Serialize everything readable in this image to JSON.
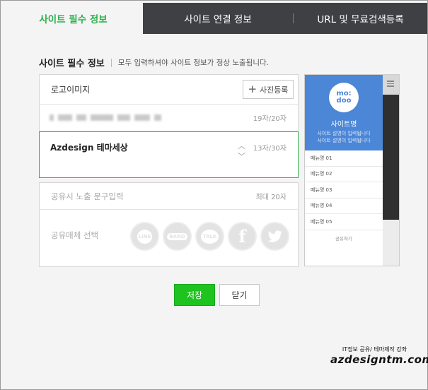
{
  "tabs": {
    "required": "사이트 필수 정보",
    "connect": "사이트 연결 정보",
    "url": "URL 및 무료검색등록"
  },
  "section": {
    "title": "사이트 필수 정보",
    "description": "모두 입력하셔야 사이트 정보가 정상 노출됩니다."
  },
  "form": {
    "logo_label": "로고이미지",
    "photo_button": "사진등록",
    "site_name_count": "19자/20자",
    "site_desc_value": "Azdesign 테마세상",
    "site_desc_count": "13자/30자",
    "share_placeholder": "공유시 노출 문구입력",
    "share_max": "최대 20자",
    "media_label": "공유매체 선택",
    "media": [
      "LINE",
      "BAND",
      "TALK",
      "f",
      "twitter"
    ]
  },
  "preview": {
    "logo_line1": "mo:",
    "logo_line2": "doo",
    "site_name": "사이트명",
    "desc1": "사이트 설명이 입력됩니다",
    "desc2": "사이트 설명이 입력됩니다",
    "menu": [
      "메뉴명 01",
      "메뉴명 02",
      "메뉴명 03",
      "메뉴명 04",
      "메뉴명 05"
    ],
    "share": "공유하기",
    "accent": "#4b86d7"
  },
  "buttons": {
    "save": "저장",
    "close": "닫기"
  },
  "watermark": {
    "line1": "IT정보 공유/ 테마제작 강좌",
    "line2": "azdesigntm.com"
  },
  "colors": {
    "accent_green": "#2bb24c",
    "save_green": "#1fc31f",
    "tab_dark": "#3e4044"
  }
}
